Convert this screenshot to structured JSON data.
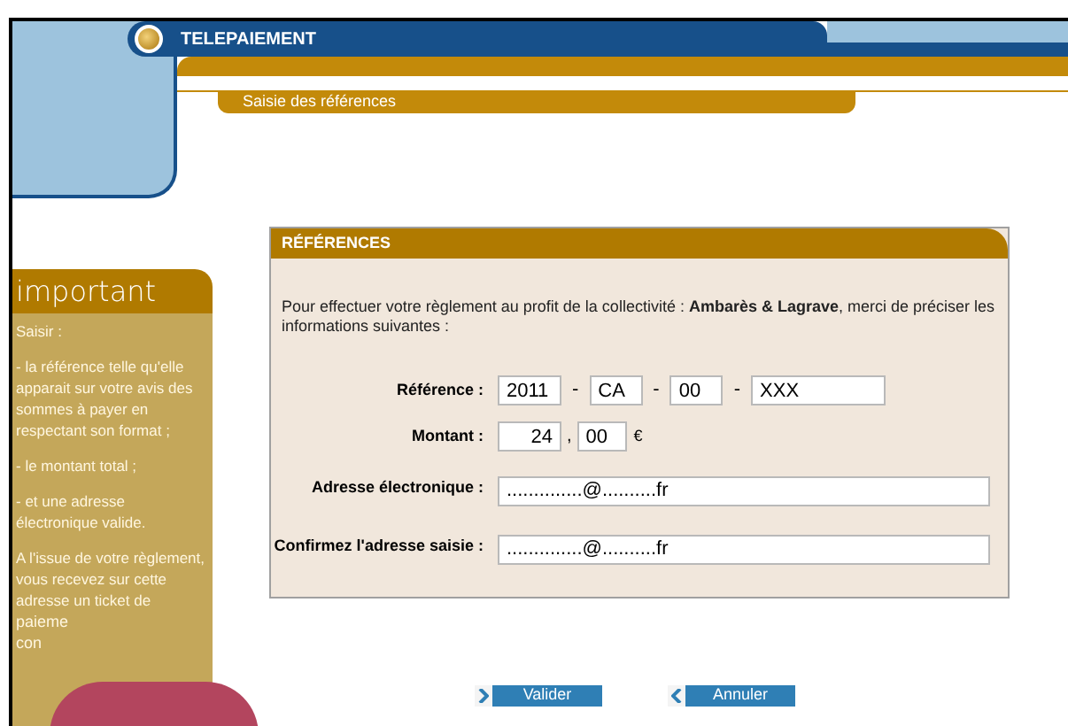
{
  "header": {
    "title": "TELEPAIEMENT",
    "subtitle": "Saisie des références"
  },
  "sidebar": {
    "title": "important",
    "paragraphs": [
      "Saisir :",
      "- la référence telle qu'elle apparait sur votre avis des sommes à payer en respectant son format ;",
      "- le montant total ;",
      "- et une adresse électronique valide.",
      "A l'issue de votre règlement, vous recevez sur cette adresse un ticket de"
    ],
    "cut_lines": [
      "paieme",
      "con"
    ]
  },
  "form": {
    "title": "RÉFÉRENCES",
    "intro": "Pour effectuer votre règlement au profit de la collectivité : **Ambarès & Lagrave**, merci de préciser les informations suivantes :",
    "reference": {
      "label": "Référence :",
      "parts": [
        "2011",
        "CA",
        "00",
        "XXX"
      ],
      "separator": "-"
    },
    "amount": {
      "label": "Montant :",
      "units": "24",
      "cents": "00",
      "separator": ",",
      "currency": "€"
    },
    "email": {
      "label": "Adresse électronique :",
      "value": "..............@..........fr"
    },
    "confirm": {
      "label": "Confirmez l'adresse saisie :",
      "value": "..............@..........fr"
    }
  },
  "buttons": [
    {
      "label": "Valider",
      "kind": "next"
    },
    {
      "label": "Annuler",
      "kind": "back"
    }
  ]
}
